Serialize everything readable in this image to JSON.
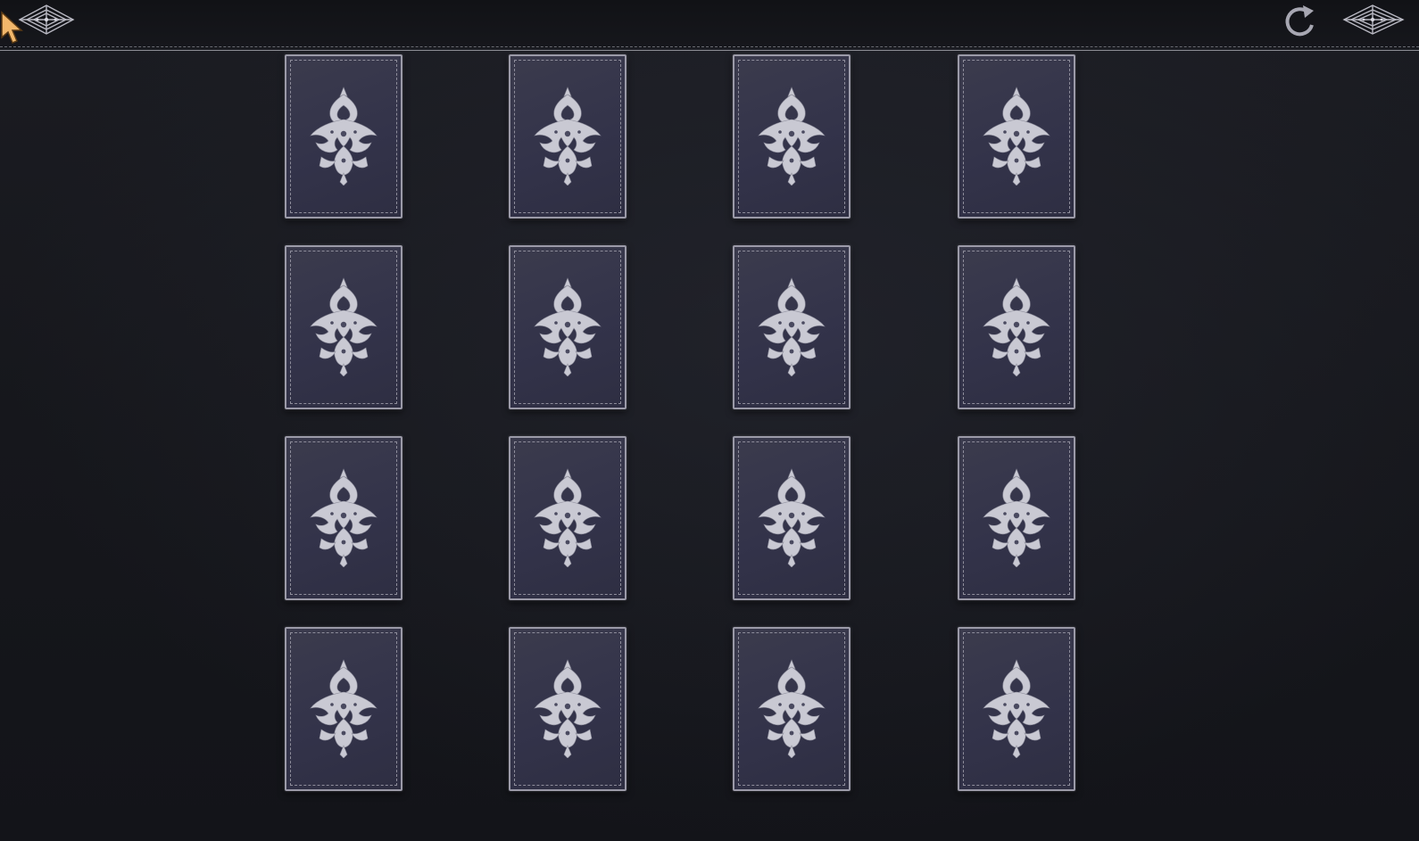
{
  "screen": "memory-card-grid",
  "colors": {
    "background": "#16171c",
    "card_face": "#36364a",
    "card_border": "#9b9aa8",
    "ornament": "#c9c9d3"
  },
  "header": {
    "back_icon": "ornate-diamond-arrow-left-icon",
    "reload_icon": "refresh-icon",
    "menu_icon": "ornate-diamond-arrow-right-icon"
  },
  "grid": {
    "rows": 4,
    "columns": 4,
    "cards": [
      {
        "state": "face-down",
        "icon": "damask-ornament-icon"
      },
      {
        "state": "face-down",
        "icon": "damask-ornament-icon"
      },
      {
        "state": "face-down",
        "icon": "damask-ornament-icon"
      },
      {
        "state": "face-down",
        "icon": "damask-ornament-icon"
      },
      {
        "state": "face-down",
        "icon": "damask-ornament-icon"
      },
      {
        "state": "face-down",
        "icon": "damask-ornament-icon"
      },
      {
        "state": "face-down",
        "icon": "damask-ornament-icon"
      },
      {
        "state": "face-down",
        "icon": "damask-ornament-icon"
      },
      {
        "state": "face-down",
        "icon": "damask-ornament-icon"
      },
      {
        "state": "face-down",
        "icon": "damask-ornament-icon"
      },
      {
        "state": "face-down",
        "icon": "damask-ornament-icon"
      },
      {
        "state": "face-down",
        "icon": "damask-ornament-icon"
      },
      {
        "state": "face-down",
        "icon": "damask-ornament-icon"
      },
      {
        "state": "face-down",
        "icon": "damask-ornament-icon"
      },
      {
        "state": "face-down",
        "icon": "damask-ornament-icon"
      },
      {
        "state": "face-down",
        "icon": "damask-ornament-icon"
      }
    ]
  }
}
